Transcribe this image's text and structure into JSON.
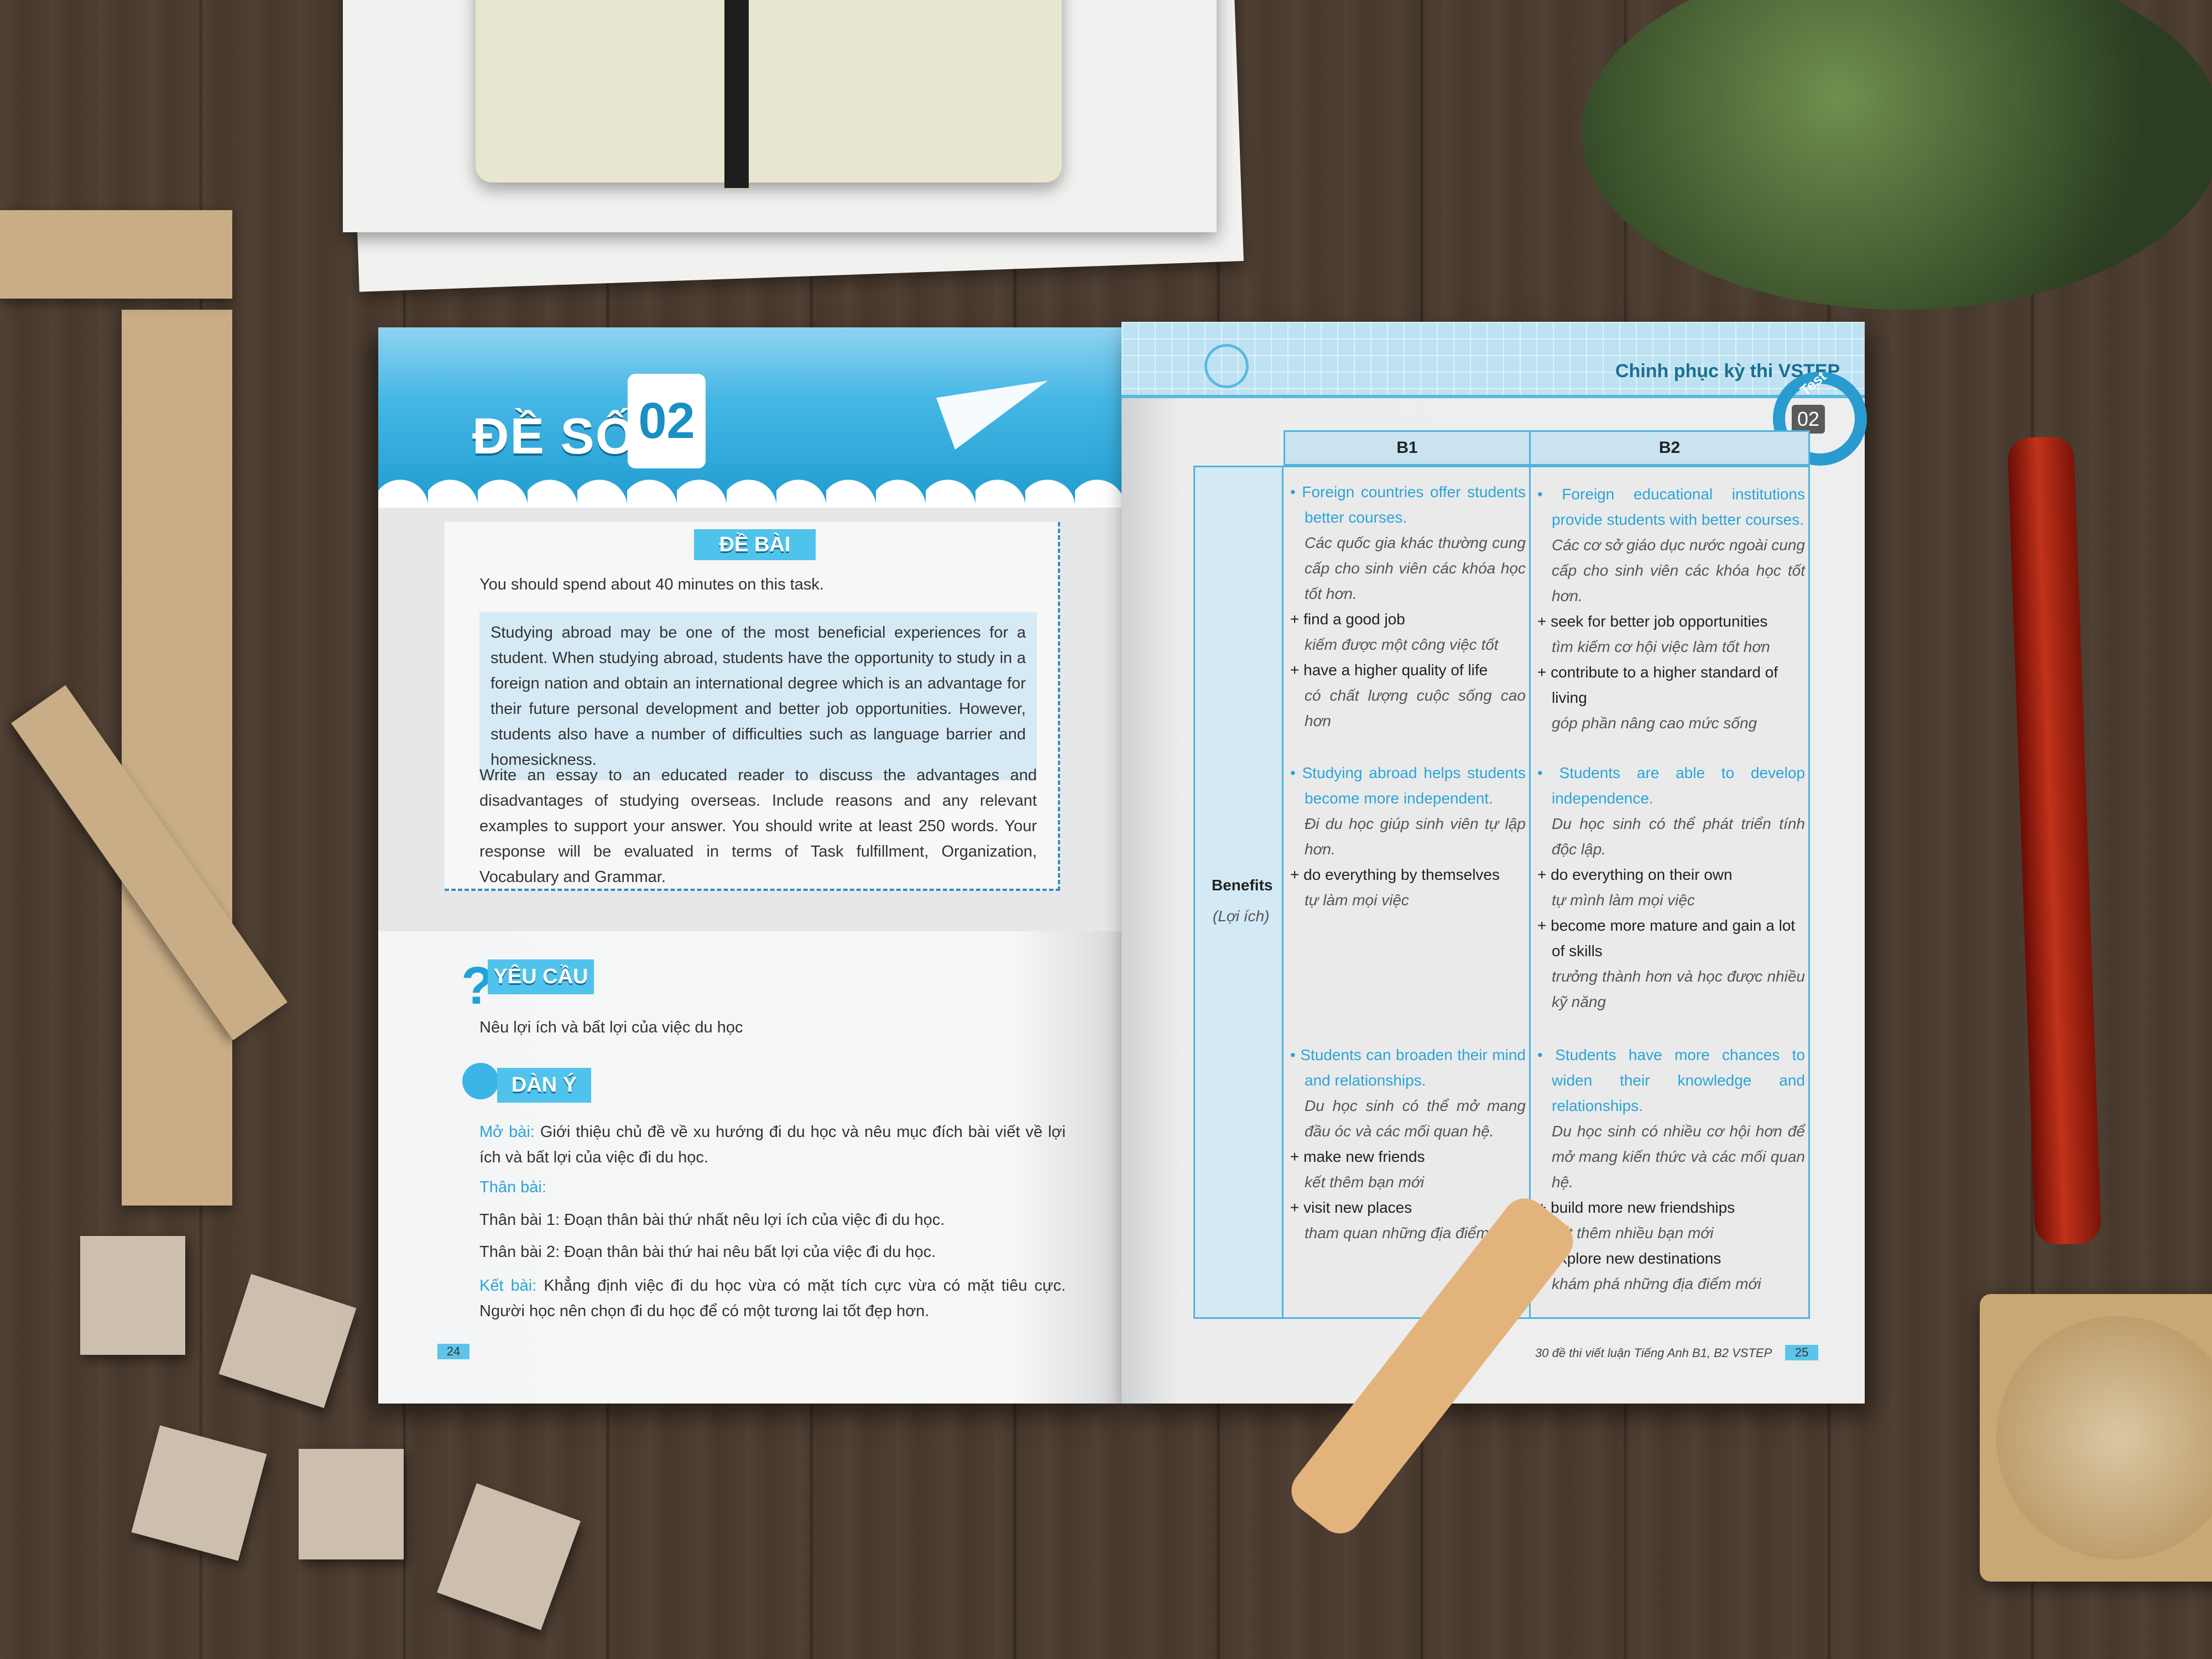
{
  "left_page": {
    "banner": {
      "title": "ĐỀ SỐ",
      "number": "02"
    },
    "task": {
      "label": "ĐỀ BÀI",
      "time_note": "You should spend about 40 minutes on this task.",
      "prompt": "Studying abroad may be one of the most beneficial experiences for a student. When studying abroad, students have the opportunity to study in a foreign nation and obtain an international degree which is an advantage for their future personal development and better job opportunities. However, students also have a number of difficulties such as language barrier and homesickness.",
      "instructions": "Write an essay to an educated reader to discuss the advantages and disadvantages of studying overseas. Include reasons and any relevant examples to support your answer. You should write at least 250 words. Your response will be evaluated in terms of Task fulfillment, Organization, Vocabulary and Grammar."
    },
    "requirement": {
      "label": "YÊU CẦU",
      "text": "Nêu lợi ích và bất lợi của việc du học"
    },
    "outline": {
      "label": "DÀN Ý",
      "intro_label": "Mở bài:",
      "intro_text": "Giới thiệu chủ đề về xu hướng đi du học và nêu mục đích bài viết về lợi ích và bất lợi của việc đi du học.",
      "body_label": "Thân bài:",
      "body_1": "Thân bài 1: Đoạn thân bài thứ nhất nêu lợi ích của việc đi du học.",
      "body_2": "Thân bài 2: Đoạn thân bài thứ hai nêu bất lợi của việc đi du học.",
      "conclusion_label": "Kết bài:",
      "conclusion_text": "Khẳng định việc đi du học vừa có mặt tích cực vừa có mặt tiêu cực. Người học nên chọn đi du học để có một tương lai tốt đẹp hơn."
    },
    "page_number": "24"
  },
  "right_page": {
    "header_title": "Chinh phục kỳ thi VSTEP",
    "badge_label": "Test",
    "badge_number": "02",
    "table": {
      "headers": [
        "B1",
        "B2"
      ],
      "row_label": "Benefits",
      "row_sublabel": "(Lợi ích)",
      "columns": [
        [
          {
            "main": "Foreign countries offer students better courses.",
            "main_vi": "Các quốc gia khác thường cung cấp cho sinh viên các khóa học tốt hơn.",
            "points": [
              {
                "en": "find a good job",
                "vi": "kiếm được một công việc tốt"
              },
              {
                "en": "have a higher quality of life",
                "vi": "có chất lượng cuộc sống cao hơn"
              }
            ]
          },
          {
            "main": "Studying abroad helps students become more independent.",
            "main_vi": "Đi du học giúp sinh viên tự lập hơn.",
            "points": [
              {
                "en": "do everything by themselves",
                "vi": "tự làm mọi việc"
              }
            ]
          },
          {
            "main": "Students can broaden their mind and relationships.",
            "main_vi": "Du học sinh có thể mở mang đầu óc và các mối quan hệ.",
            "points": [
              {
                "en": "make new friends",
                "vi": "kết thêm bạn mới"
              },
              {
                "en": "visit new places",
                "vi": "tham quan những địa điểm mới"
              }
            ]
          }
        ],
        [
          {
            "main": "Foreign educational institutions provide students with better courses.",
            "main_vi": "Các cơ sở giáo dục nước ngoài cung cấp cho sinh viên các khóa học tốt hơn.",
            "points": [
              {
                "en": "seek for better job opportunities",
                "vi": "tìm kiếm cơ hội việc làm tốt hơn"
              },
              {
                "en": "contribute to a higher standard of living",
                "vi": "góp phần nâng cao mức sống"
              }
            ]
          },
          {
            "main": "Students are able to develop independence.",
            "main_vi": "Du học sinh có thể phát triển tính độc lập.",
            "points": [
              {
                "en": "do everything on their own",
                "vi": "tự mình làm mọi việc"
              },
              {
                "en": "become more mature and gain a lot of skills",
                "vi": "trưởng thành hơn và học được nhiều kỹ năng"
              }
            ]
          },
          {
            "main": "Students have more chances to widen their knowledge and relationships.",
            "main_vi": "Du học sinh có nhiều cơ hội hơn để mở mang kiến thức và các mối quan hệ.",
            "points": [
              {
                "en": "build more new friendships",
                "vi": "kết thêm nhiều bạn mới"
              },
              {
                "en": "explore new destinations",
                "vi": "khám phá những địa điểm mới"
              }
            ]
          }
        ]
      ]
    },
    "footer": "30 đề thi viết luận Tiếng Anh B1, B2 VSTEP",
    "page_number": "25"
  },
  "colors": {
    "accent": "#2aa4d8",
    "label_bg": "#4fc3ec",
    "wood": "#4b3b2f"
  }
}
